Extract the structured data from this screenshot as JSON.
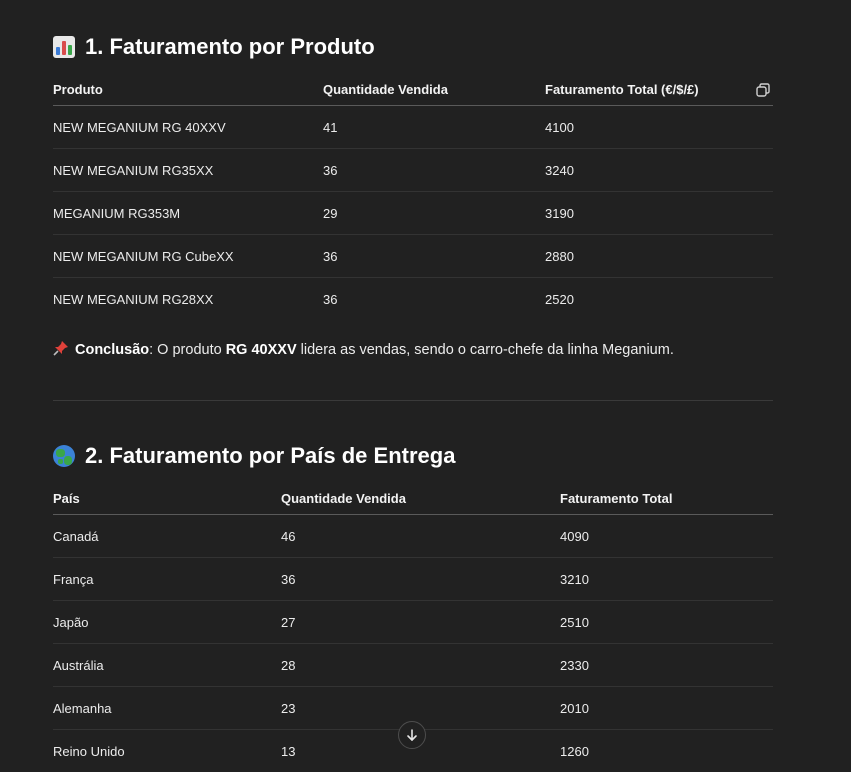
{
  "section1": {
    "title": "1. Faturamento por Produto",
    "headers": [
      "Produto",
      "Quantidade Vendida",
      "Faturamento Total (€/$/£)"
    ],
    "rows": [
      [
        "NEW MEGANIUM RG 40XXV",
        "41",
        "4100"
      ],
      [
        "NEW MEGANIUM RG35XX",
        "36",
        "3240"
      ],
      [
        "MEGANIUM RG353M",
        "29",
        "3190"
      ],
      [
        "NEW MEGANIUM RG CubeXX",
        "36",
        "2880"
      ],
      [
        "NEW MEGANIUM RG28XX",
        "36",
        "2520"
      ]
    ],
    "conclusion": {
      "label": "Conclusão",
      "text_before": ": O produto ",
      "highlight": "RG 40XXV",
      "text_after": " lidera as vendas, sendo o carro-chefe da linha Meganium."
    }
  },
  "section2": {
    "title": "2. Faturamento por País de Entrega",
    "headers": [
      "País",
      "Quantidade Vendida",
      "Faturamento Total"
    ],
    "rows": [
      [
        "Canadá",
        "46",
        "4090"
      ],
      [
        "França",
        "36",
        "3210"
      ],
      [
        "Japão",
        "27",
        "2510"
      ],
      [
        "Austrália",
        "28",
        "2330"
      ],
      [
        "Alemanha",
        "23",
        "2010"
      ],
      [
        "Reino Unido",
        "13",
        "1260"
      ]
    ]
  },
  "icons": {
    "section1_icon": "bar-chart-icon",
    "section2_icon": "globe-icon",
    "copy": "copy-icon",
    "pin": "pushpin-icon",
    "scroll": "arrow-down-icon"
  },
  "colors": {
    "background": "#212121",
    "text": "#ececec",
    "heading": "#ffffff"
  }
}
